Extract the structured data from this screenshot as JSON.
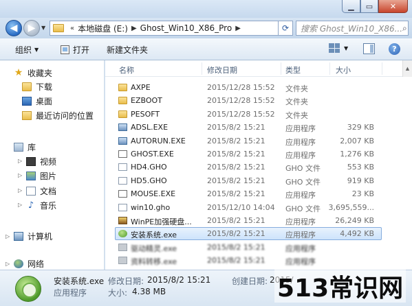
{
  "address": {
    "crumbs": [
      "本地磁盘 (E:)",
      "Ghost_Win10_X86_Pro"
    ],
    "lead_sep": "«",
    "search_placeholder": "搜索 Ghost_Win10_X86..."
  },
  "toolbar": {
    "organize": "组织",
    "open": "打开",
    "new_folder": "新建文件夹"
  },
  "nav": {
    "favorites": "收藏夹",
    "downloads": "下载",
    "desktop": "桌面",
    "recent": "最近访问的位置",
    "libraries": "库",
    "videos": "视频",
    "pictures": "图片",
    "documents": "文档",
    "music": "音乐",
    "computer": "计算机",
    "network": "网络"
  },
  "columns": {
    "name": "名称",
    "modified": "修改日期",
    "type": "类型",
    "size": "大小"
  },
  "files": [
    {
      "name": "AXPE",
      "modified": "2015/12/28 15:52",
      "type": "文件夹",
      "size": "",
      "icon": "folder-icon"
    },
    {
      "name": "EZBOOT",
      "modified": "2015/12/28 15:52",
      "type": "文件夹",
      "size": "",
      "icon": "folder-icon"
    },
    {
      "name": "PESOFT",
      "modified": "2015/12/28 15:52",
      "type": "文件夹",
      "size": "",
      "icon": "folder-icon"
    },
    {
      "name": "ADSL.EXE",
      "modified": "2015/8/2 15:21",
      "type": "应用程序",
      "size": "329 KB",
      "icon": "exe-icon"
    },
    {
      "name": "AUTORUN.EXE",
      "modified": "2015/8/2 15:21",
      "type": "应用程序",
      "size": "2,007 KB",
      "icon": "exe-icon"
    },
    {
      "name": "GHOST.EXE",
      "modified": "2015/8/2 15:21",
      "type": "应用程序",
      "size": "1,276 KB",
      "icon": "ghost-icon"
    },
    {
      "name": "HD4.GHO",
      "modified": "2015/8/2 15:21",
      "type": "GHO 文件",
      "size": "553 KB",
      "icon": "gho-file-icon"
    },
    {
      "name": "HD5.GHO",
      "modified": "2015/8/2 15:21",
      "type": "GHO 文件",
      "size": "919 KB",
      "icon": "gho-file-icon"
    },
    {
      "name": "MOUSE.EXE",
      "modified": "2015/8/2 15:21",
      "type": "应用程序",
      "size": "23 KB",
      "icon": "ghost-icon"
    },
    {
      "name": "win10.gho",
      "modified": "2015/12/10 14:04",
      "type": "GHO 文件",
      "size": "3,695,559...",
      "icon": "gho-file-icon"
    },
    {
      "name": "WinPE加强硬盘...",
      "modified": "2015/8/2 15:21",
      "type": "应用程序",
      "size": "26,249 KB",
      "icon": "winpe-icon"
    },
    {
      "name": "安装系统.exe",
      "modified": "2015/8/2 15:21",
      "type": "应用程序",
      "size": "4,492 KB",
      "icon": "setup-icon",
      "selected": true
    },
    {
      "name": "驱动精灵.exe",
      "modified": "2015/8/2 15:21",
      "type": "应用程序",
      "size": "",
      "icon": "app-icon"
    },
    {
      "name": "资料转移.exe",
      "modified": "2015/8/2 15:21",
      "type": "应用程序",
      "size": "",
      "icon": "app-icon"
    }
  ],
  "details": {
    "name": "安装系统.exe",
    "modified_label": "修改日期:",
    "modified_value": "2015/8/2 15:21",
    "created_label": "创建日期:",
    "created_value": "2015/",
    "type_text": "应用程序",
    "size_label": "大小:",
    "size_value": "4.38 MB"
  },
  "watermark": "513常识网"
}
